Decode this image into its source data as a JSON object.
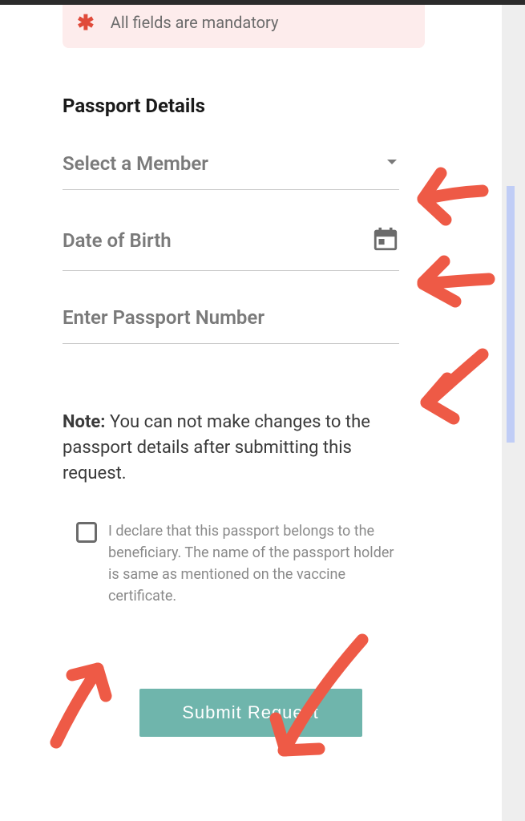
{
  "notice": {
    "text": "All fields are mandatory"
  },
  "section_title": "Passport Details",
  "fields": {
    "member": {
      "label": "Select a Member"
    },
    "dob": {
      "label": "Date of Birth"
    },
    "passport": {
      "label": "Enter Passport Number"
    }
  },
  "note": {
    "prefix": "Note:",
    "body": "You can not make changes to the passport details after submitting this request."
  },
  "declare": {
    "text": "I declare that this passport belongs to the beneficiary. The name of the passport holder is same as mentioned on the vaccine certificate."
  },
  "submit_label": "Submit Request"
}
